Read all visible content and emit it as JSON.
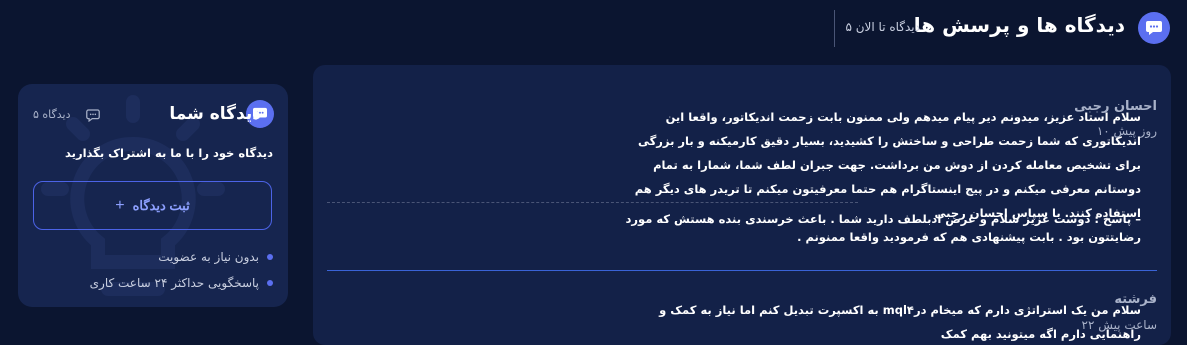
{
  "header": {
    "title": "دیدگاه ها و پرسش ها",
    "count": "۵ دیدگاه تا الان"
  },
  "sidebar": {
    "title": "دیدگاه شما",
    "count": "۵ دیدگاه",
    "description": "دیدگاه خود را با ما به اشتراک بگذارید",
    "button_label": "ثبت دیدگاه",
    "features": [
      "بدون نیاز به عضویت",
      "پاسخگویی حداکثر ۲۴ ساعت کاری"
    ]
  },
  "comments": [
    {
      "author": "احسان رجبی",
      "time": "۱۰ روز پیش",
      "text": "سلام استاد عزیز، میدونم دیر پیام میدهم ولی ممنون بابت زحمت اندیکاتور، واقعا این اندیکاتوری که شما زحمت طراحی و ساختش را کشیدید، بسیار دقیق کارمیکنه و بار بزرگی برای تشخیص معامله کردن از دوش من برداشت. جهت جبران لطف شما، شمارا به تمام دوستانم معرفی میکنم و در پیج اینستاگرام هم حتما معرفیتون میکنم تا تریدر های دیگر هم استفاده کنند. با سپاس احسان رجبی",
      "reply": "– پاسخ : دوست عزیز سلام و عرض ادبلطف دارید شما . باعث خرسندی بنده هستش که مورد رضایتتون بود . بابت پیشنهادی هم که فرمودید واقعا ممنونم ."
    },
    {
      "author": "فرشته",
      "time": "۲۲ ساعت پیش",
      "text": "سلام من یک استراتژی دارم که میخام درmql۴ به اکسپرت تبدیل کنم اما نیاز به کمک و راهنمایی دارم اگه میتونید بهم کمک"
    }
  ]
}
